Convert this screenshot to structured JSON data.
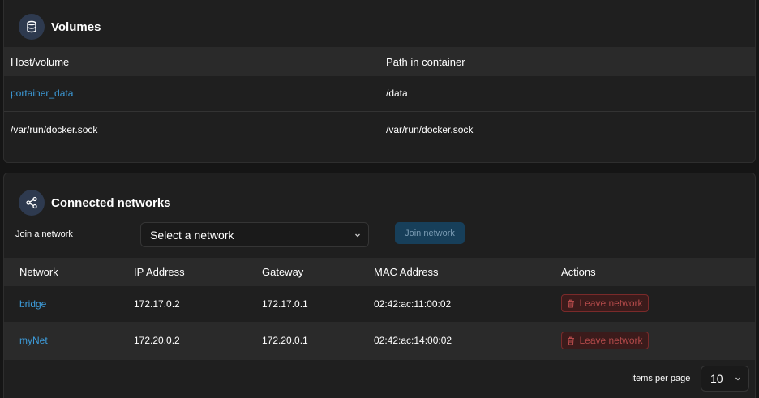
{
  "volumes": {
    "title": "Volumes",
    "icon": "database-icon",
    "columns": [
      "Host/volume",
      "Path in container"
    ],
    "rows": [
      {
        "host": "portainer_data",
        "path": "/data"
      },
      {
        "host": "/var/run/docker.sock",
        "path": "/var/run/docker.sock"
      }
    ]
  },
  "networks": {
    "title": "Connected networks",
    "icon": "share-icon",
    "join_label": "Join a network",
    "select_placeholder": "Select a network",
    "join_button": "Join network",
    "columns": [
      "Network",
      "IP Address",
      "Gateway",
      "MAC Address",
      "Actions"
    ],
    "rows": [
      {
        "network": "bridge",
        "ip": "172.17.0.2",
        "gateway": "172.17.0.1",
        "mac": "02:42:ac:11:00:02",
        "action": "Leave network"
      },
      {
        "network": "myNet",
        "ip": "172.20.0.2",
        "gateway": "172.20.0.1",
        "mac": "02:42:ac:14:00:02",
        "action": "Leave network"
      }
    ],
    "items_per_page_label": "Items per page",
    "items_per_page_value": "10"
  },
  "colors": {
    "link": "#3d9cdb",
    "danger": "#b34a4a",
    "primary_disabled": "#173f5a"
  }
}
